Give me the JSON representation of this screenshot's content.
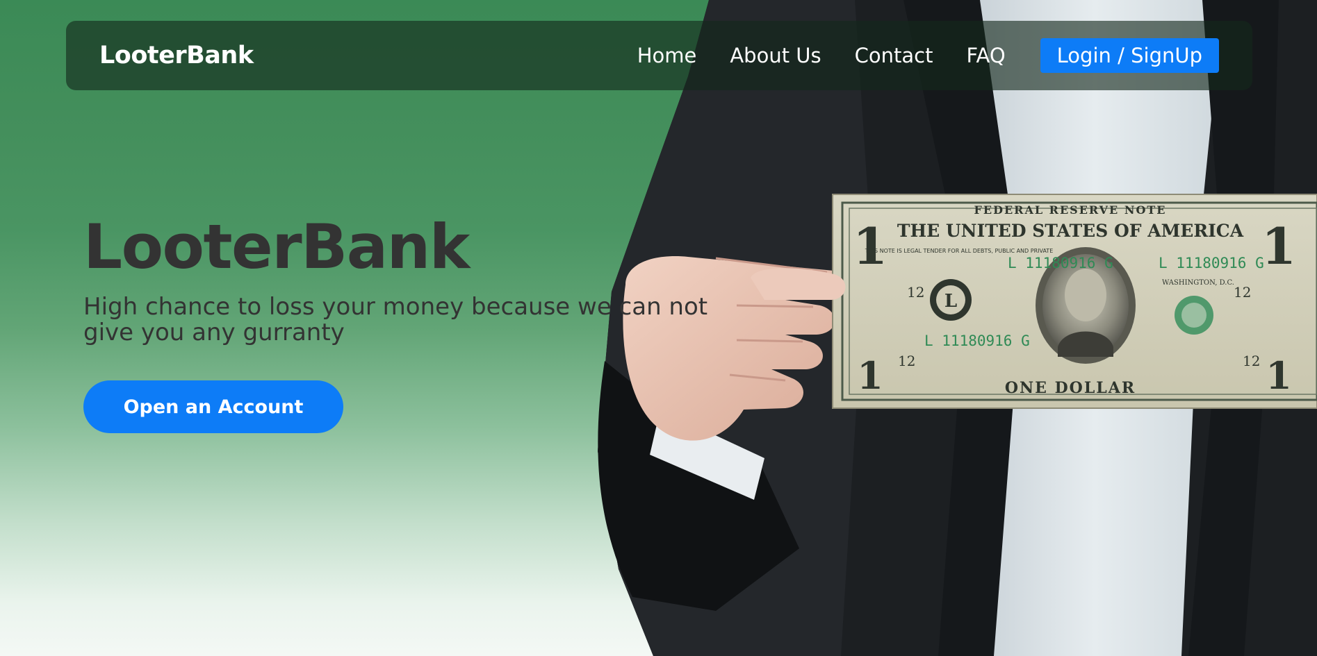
{
  "navbar": {
    "brand": "LooterBank",
    "links": [
      "Home",
      "About Us",
      "Contact",
      "FAQ"
    ],
    "login_label": "Login / SignUp"
  },
  "hero": {
    "title": "LooterBank",
    "subtitle": "High chance to loss your money because we can not give you any gurranty",
    "cta_label": "Open an Account"
  },
  "banknote": {
    "header": "FEDERAL RESERVE NOTE",
    "country": "THE UNITED STATES OF AMERICA",
    "legal": "THIS NOTE IS LEGAL TENDER FOR ALL DEBTS, PUBLIC AND PRIVATE",
    "serial": "L 11180916 G",
    "city": "WASHINGTON, D.C.",
    "denomination": "ONE DOLLAR",
    "corner_value": "1",
    "district_number": "12",
    "district_letter": "L"
  },
  "colors": {
    "accent": "#0d7cf7",
    "hero_text": "#333333",
    "background_top": "#3b8a56",
    "navbar_bg": "rgba(20, 40, 28, 0.62)"
  }
}
